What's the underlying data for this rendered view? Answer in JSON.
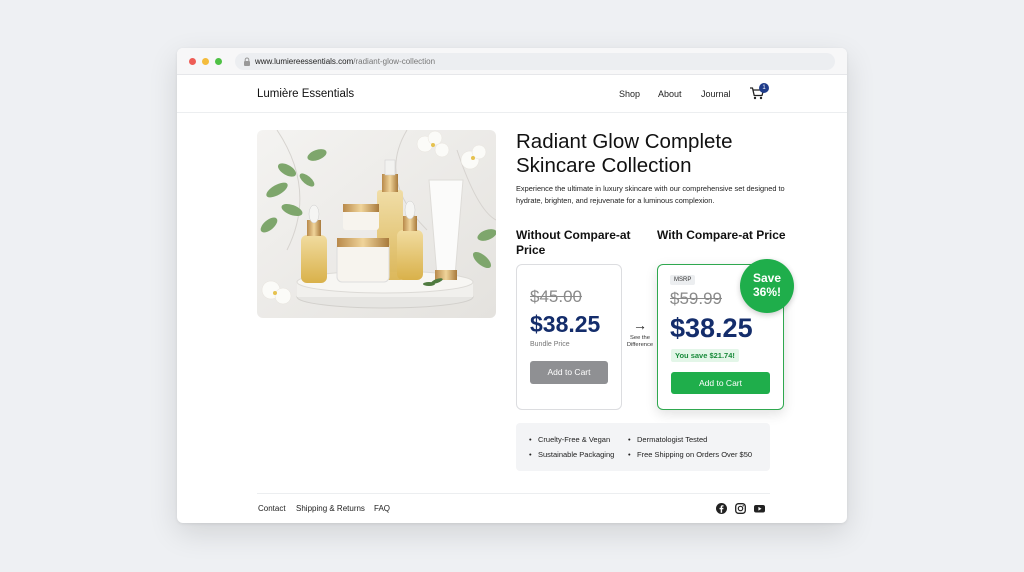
{
  "browser": {
    "url_host": "www.lumiereessentials.com",
    "url_path": "/radiant-glow-collection"
  },
  "header": {
    "brand": "Lumière Essentials",
    "nav": [
      "Shop",
      "About",
      "Journal"
    ],
    "cart_count": "1"
  },
  "product": {
    "title": "Radiant Glow Complete Skincare Collection",
    "description": "Experience the ultimate in luxury skincare with our comprehensive set designed to hydrate, brighten, and rejuvenate for a luminous complexion."
  },
  "comparison": {
    "without": {
      "heading": "Without Compare-at Price",
      "old_price": "$45.00",
      "price": "$38.25",
      "caption": "Bundle Price",
      "button": "Add to Cart"
    },
    "arrow_label": "See the Difference",
    "with": {
      "heading": "With Compare-at Price",
      "tag": "MSRP",
      "old_price": "$59.99",
      "price": "$38.25",
      "savings": "You save $21.74!",
      "button": "Add to Cart",
      "badge_line1": "Save",
      "badge_line2": "36%!"
    }
  },
  "features": [
    "Cruelty-Free & Vegan",
    "Dermatologist Tested",
    "Sustainable Packaging",
    "Free Shipping on Orders Over $50"
  ],
  "footer": {
    "links": [
      "Contact",
      "Shipping & Returns",
      "FAQ"
    ],
    "social_icons": [
      "facebook-icon",
      "instagram-icon",
      "youtube-icon"
    ]
  },
  "colors": {
    "accent_green": "#1fae4b",
    "price_navy": "#142d6b",
    "disabled_grey": "#8f9093"
  }
}
